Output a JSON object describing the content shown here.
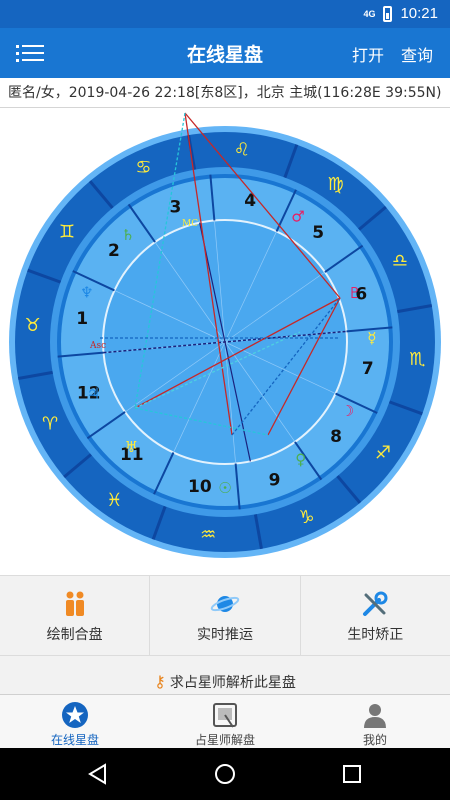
{
  "status": {
    "network": "4G",
    "time": "10:21"
  },
  "appbar": {
    "title": "在线星盘",
    "open_label": "打开",
    "search_label": "查询",
    "menu_icon": "menu-icon"
  },
  "info": {
    "text": "匿名/女，2019-04-26 22:18[东8区]，北京 主城(116:28E 39:55N)"
  },
  "chart": {
    "houses": [
      "1",
      "2",
      "3",
      "4",
      "5",
      "6",
      "7",
      "8",
      "9",
      "10",
      "11",
      "12"
    ],
    "mc_label": "MC",
    "asc_label": "Asc",
    "zodiac_glyphs": [
      "♈",
      "♉",
      "♊",
      "♋",
      "♌",
      "♍",
      "♎",
      "♏",
      "♐",
      "♑",
      "♒",
      "♓"
    ],
    "planet_glyphs": [
      "☉",
      "☽",
      "☿",
      "♀",
      "♂",
      "♃",
      "♄",
      "♅",
      "♆",
      "♇"
    ],
    "colors": {
      "ring_dark": "#1565c0",
      "ring_light": "#64b5f6",
      "inner": "#4aa8ef"
    }
  },
  "tools": [
    {
      "label": "绘制合盘",
      "icon": "couple-icon"
    },
    {
      "label": "实时推运",
      "icon": "planet-icon"
    },
    {
      "label": "生时矫正",
      "icon": "wrench-icon"
    }
  ],
  "consult": {
    "label": "求占星师解析此星盘",
    "icon": "key-icon"
  },
  "tabs": [
    {
      "label": "在线星盘",
      "icon": "star-icon",
      "active": true
    },
    {
      "label": "占星师解盘",
      "icon": "tablet-icon",
      "active": false
    },
    {
      "label": "我的",
      "icon": "user-icon",
      "active": false
    }
  ]
}
